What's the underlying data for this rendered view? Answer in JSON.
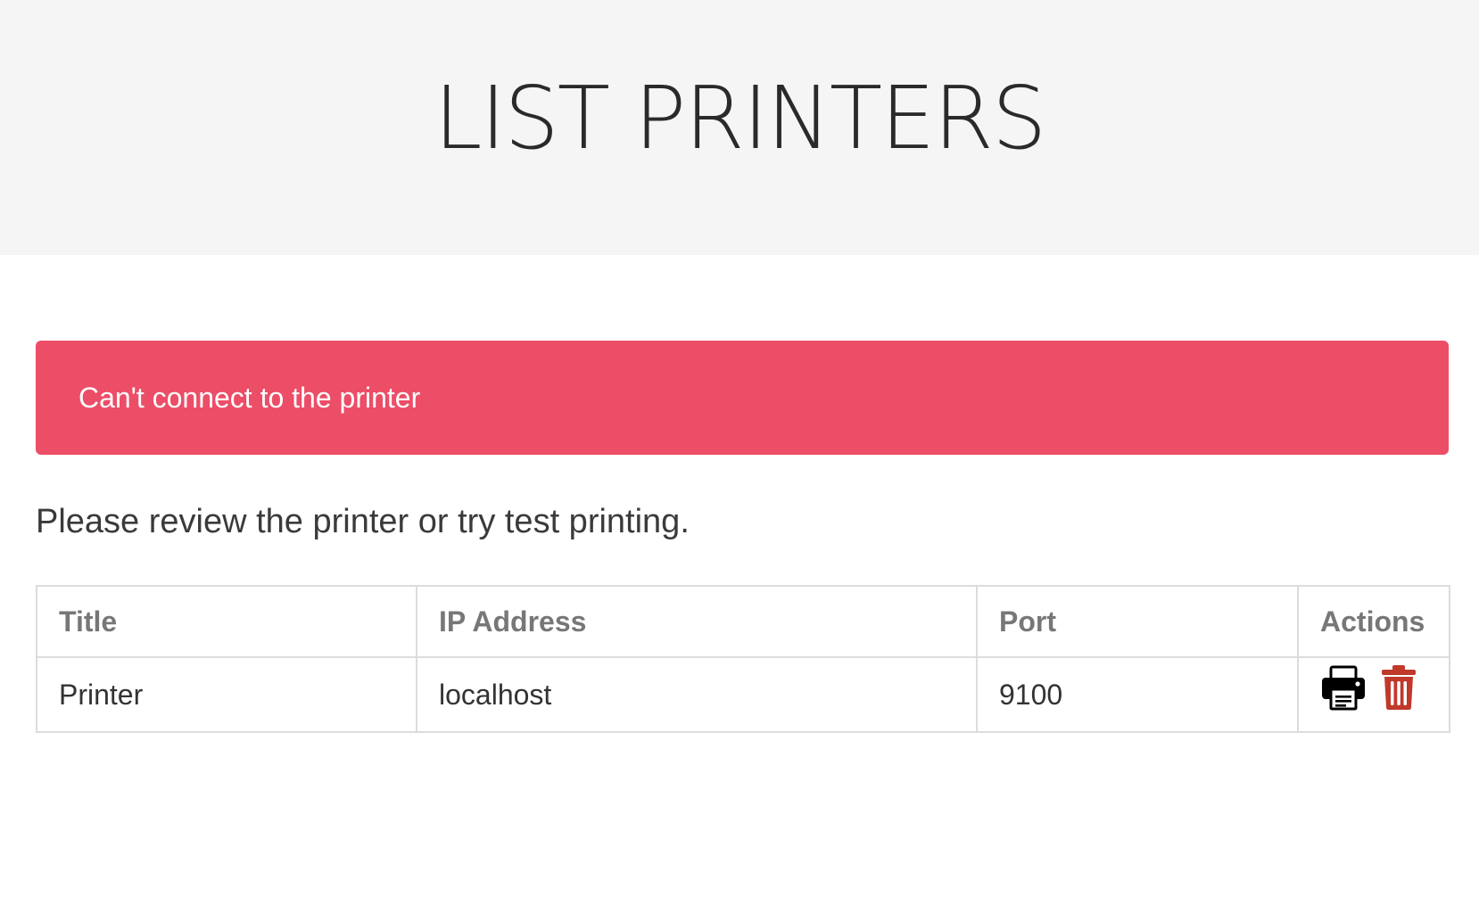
{
  "header": {
    "title": "LIST PRINTERS"
  },
  "alert": {
    "message": "Can't connect to the printer",
    "color": "#ec4d67"
  },
  "intro": {
    "text": "Please review the printer or try test printing."
  },
  "table": {
    "headers": [
      "Title",
      "IP Address",
      "Port",
      "Actions"
    ],
    "rows": [
      {
        "title": "Printer",
        "ip": "localhost",
        "port": "9100",
        "actions": [
          {
            "icon": "print-icon",
            "color": "#000000"
          },
          {
            "icon": "trash-icon",
            "color": "#c0392b"
          }
        ]
      }
    ]
  }
}
